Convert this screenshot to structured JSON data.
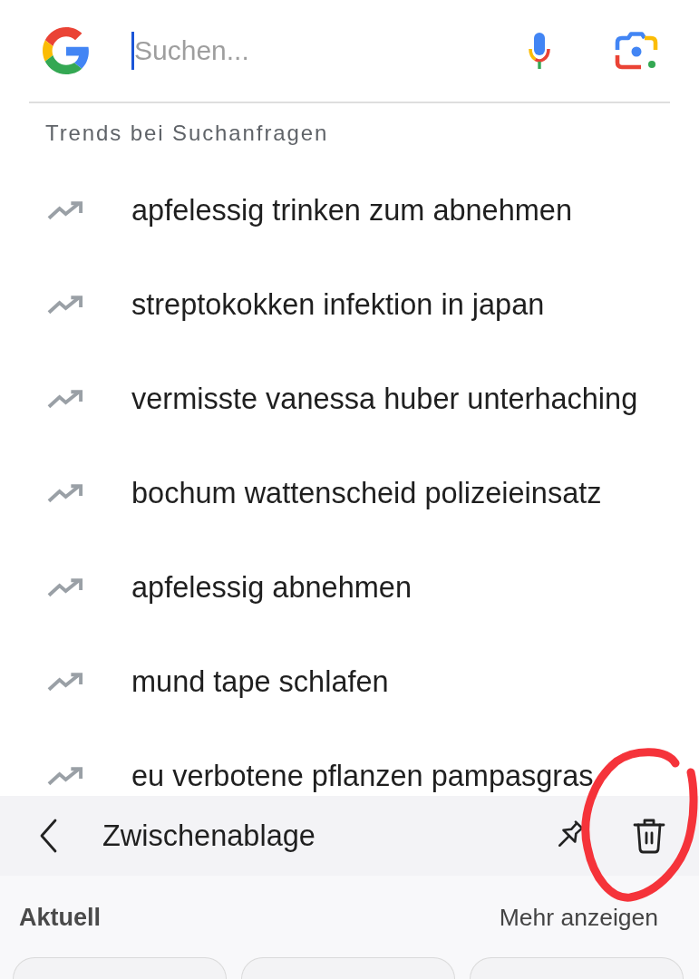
{
  "search": {
    "placeholder": "Suchen...",
    "focused": true
  },
  "trends": {
    "title": "Trends bei Suchanfragen",
    "items": [
      "apfelessig trinken zum abnehmen",
      "streptokokken infektion in japan",
      "vermisste vanessa huber unterhaching",
      "bochum wattenscheid polizeieinsatz",
      "apfelessig abnehmen",
      "mund tape schlafen",
      "eu verbotene pflanzen pampasgras"
    ]
  },
  "clipboard": {
    "title": "Zwischenablage",
    "section": "Aktuell",
    "more_link": "Mehr anzeigen"
  },
  "annotation": {
    "kind": "circle"
  }
}
